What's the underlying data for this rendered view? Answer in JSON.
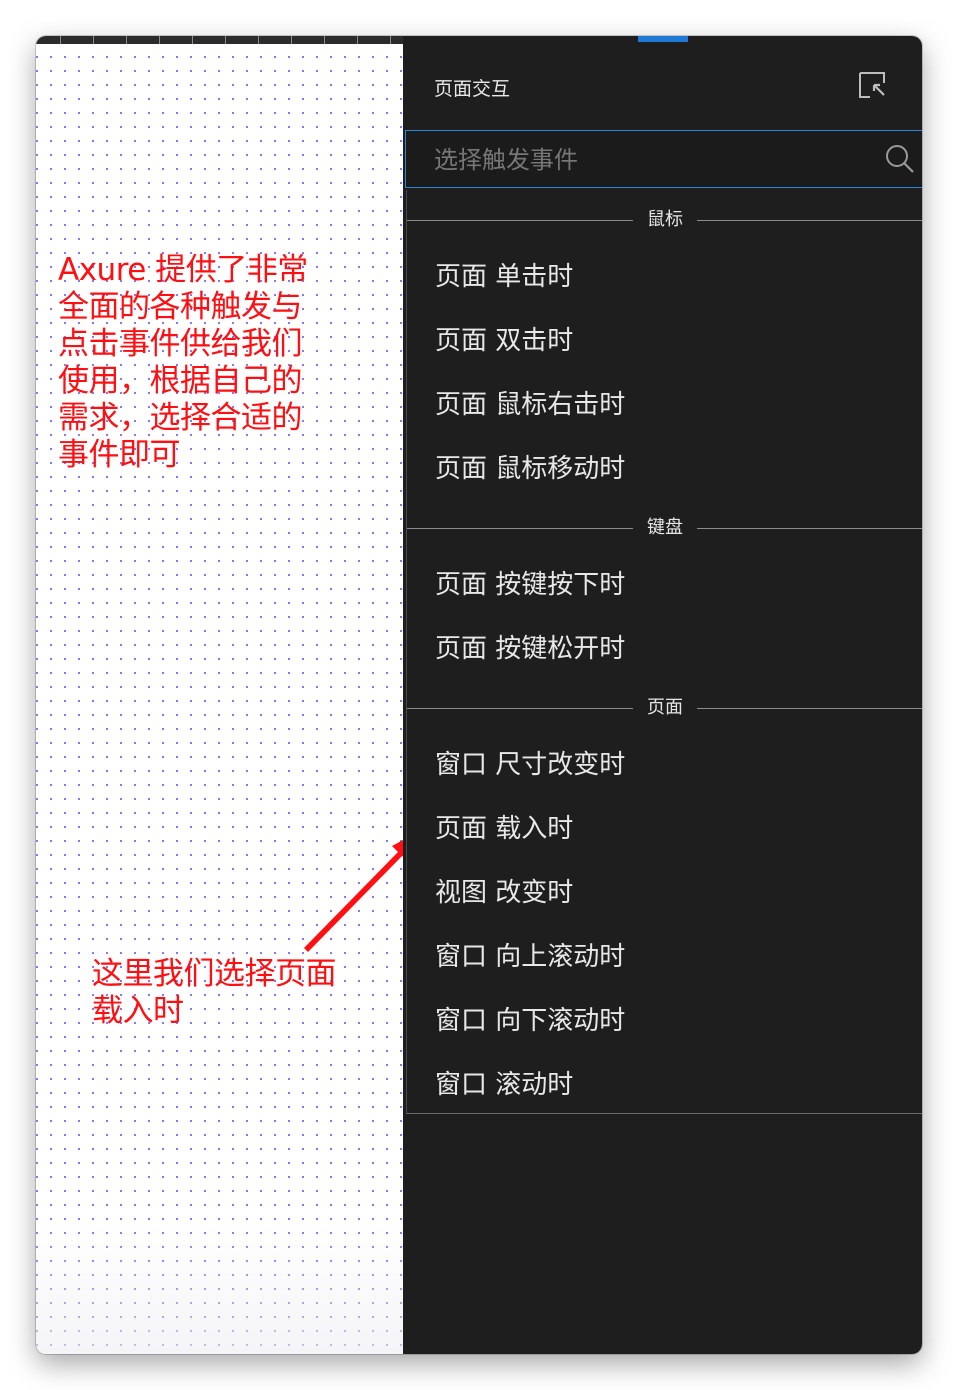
{
  "annotations": {
    "note_primary": "Axure 提供了非常\n全面的各种触发与\n点击事件供给我们\n使用，根据自己的\n需求，选择合适的\n事件即可",
    "note_secondary": "这里我们选择页面\n载入时"
  },
  "panel": {
    "title": "页面交互",
    "search": {
      "placeholder": "选择触发事件",
      "value": ""
    },
    "sections": [
      {
        "label": "鼠标",
        "items": [
          "页面 单击时",
          "页面 双击时",
          "页面 鼠标右击时",
          "页面 鼠标移动时"
        ]
      },
      {
        "label": "键盘",
        "items": [
          "页面 按键按下时",
          "页面 按键松开时"
        ]
      },
      {
        "label": "页面",
        "items": [
          "窗口 尺寸改变时",
          "页面 载入时",
          "视图 改变时",
          "窗口 向上滚动时",
          "窗口 向下滚动时",
          "窗口 滚动时"
        ]
      }
    ]
  },
  "icons": {
    "collapse": "collapse-panel-icon",
    "search": "search-icon",
    "arrow": "annotation-arrow"
  },
  "colors": {
    "panel_bg": "#1e1e1e",
    "accent": "#1f7ad6",
    "annotation": "#ff0f12",
    "grid_dot": "#7a6cf0"
  }
}
